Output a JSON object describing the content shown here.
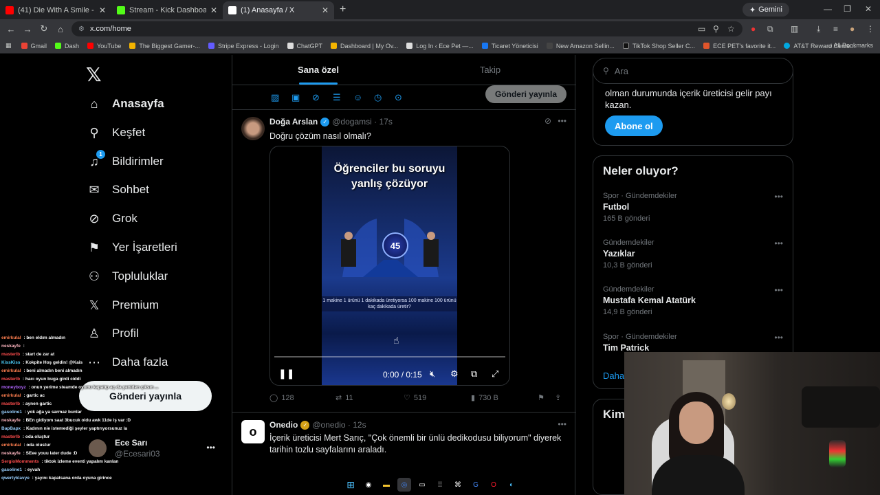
{
  "browser": {
    "tabs": [
      {
        "title": "(41) Die With A Smile - Lady Ga",
        "fav_color": "#ff0000",
        "active": false
      },
      {
        "title": "Stream - Kick Dashboard",
        "fav_color": "#53fc18",
        "active": false
      },
      {
        "title": "(1) Anasayfa / X",
        "fav_color": "#ffffff",
        "active": true
      }
    ],
    "new_tab": "+",
    "gemini": "Gemini",
    "url": "x.com/home",
    "bookmarks": [
      {
        "label": "Gmail",
        "color": "#ea4335"
      },
      {
        "label": "Dash",
        "color": "#53fc18"
      },
      {
        "label": "YouTube",
        "color": "#ff0000"
      },
      {
        "label": "The Biggest Gamer-...",
        "color": "#f4b400"
      },
      {
        "label": "Stripe Express - Login",
        "color": "#635bff"
      },
      {
        "label": "ChatGPT",
        "color": "#dddddd"
      },
      {
        "label": "Dashboard | My Ov...",
        "color": "#f4b400"
      },
      {
        "label": "Log In ‹ Ece Pet —...",
        "color": "#dddddd"
      },
      {
        "label": "Ticaret Yöneticisi",
        "color": "#1877f2"
      },
      {
        "label": "New Amazon Sellin...",
        "color": "#222222"
      },
      {
        "label": "TikTok Shop Seller C...",
        "color": "#111111"
      },
      {
        "label": "ECE PET's favorite it...",
        "color": "#e0552b"
      },
      {
        "label": "AT&T Reward Cente...",
        "color": "#00a8e0"
      }
    ],
    "all_bookmarks": "All Bookmarks"
  },
  "nav": {
    "items": [
      {
        "label": "Anasayfa",
        "icon": "home-icon",
        "glyph": "⌂"
      },
      {
        "label": "Keşfet",
        "icon": "search-icon",
        "glyph": "⚲"
      },
      {
        "label": "Bildirimler",
        "icon": "bell-icon",
        "glyph": "🔔︎"
      },
      {
        "label": "Sohbet",
        "icon": "mail-icon",
        "glyph": "✉"
      },
      {
        "label": "Grok",
        "icon": "grok-icon",
        "glyph": "⊘"
      },
      {
        "label": "Yer İşaretleri",
        "icon": "bookmark-icon",
        "glyph": "🔖︎"
      },
      {
        "label": "Topluluklar",
        "icon": "communities-icon",
        "glyph": "👥︎"
      },
      {
        "label": "Premium",
        "icon": "x-premium-icon",
        "glyph": "𝕏"
      },
      {
        "label": "Profil",
        "icon": "profile-icon",
        "glyph": "👤︎"
      },
      {
        "label": "Daha fazla",
        "icon": "more-circle-icon",
        "glyph": "⋯"
      }
    ],
    "notif_count": "1",
    "post_button": "Gönderi yayınla",
    "account": {
      "name": "Ece Sarı",
      "handle": "@Ecesari03"
    }
  },
  "feed": {
    "tabs": [
      "Sana özel",
      "Takip"
    ],
    "composer_post_button": "Gönderi yayınla",
    "posts": [
      {
        "name": "Doğa Arslan",
        "handle": "@dogamsi",
        "time": "17s",
        "text": "Doğru çözüm nasıl olmalı?",
        "video": {
          "overlay_title": "Öğrenciler bu soruyu yanlış çözüyor",
          "badge": "45",
          "question": "1 makine 1 ürünü 1 dakikada üretiyorsa 100 makine 100 ürünü kaç dakikada üretir?",
          "time": "0:00 / 0:15",
          "progress": 0
        },
        "stats": {
          "replies": "128",
          "reposts": "11",
          "likes": "519",
          "views": "730 B"
        }
      },
      {
        "name": "Onedio",
        "handle": "@onedio",
        "time": "12s",
        "text": "İçerik üreticisi Mert Sarıç, \"Çok önemli bir ünlü dedikodusu biliyorum\" diyerek tarihin tozlu sayfalarını araladı."
      }
    ]
  },
  "right": {
    "search_placeholder": "Ara",
    "premium_text": "olman durumunda içerik üreticisi gelir payı kazan.",
    "subscribe_button": "Abone ol",
    "trends_title": "Neler oluyor?",
    "trends": [
      {
        "context": "Spor · Gündemdekiler",
        "name": "Futbol",
        "posts": "165 B gönderi"
      },
      {
        "context": "Gündemdekiler",
        "name": "Yazıklar",
        "posts": "10,3 B gönderi"
      },
      {
        "context": "Gündemdekiler",
        "name": "Mustafa Kemal Atatürk",
        "posts": "14,9 B gönderi"
      },
      {
        "context": "Spor · Gündemdekiler",
        "name": "Tim Patrick",
        "posts": ""
      }
    ],
    "show_more": "Daha",
    "who_to_follow": "Kim"
  },
  "chat": [
    {
      "user": "emirkulal",
      "color": "#ff7f50",
      "msg": "ben eldım almadın"
    },
    {
      "user": "neskayfe",
      "color": "#ffb6c1",
      "msg": ""
    },
    {
      "user": "masterlb",
      "color": "#ff4d4d",
      "msg": "start de zar at"
    },
    {
      "user": "KissKiss",
      "color": "#4dd2ff",
      "msg": "Kokpite Hoş geldin! @Kais"
    },
    {
      "user": "emirkulal",
      "color": "#ff7f50",
      "msg": "beni almadın beni almadın"
    },
    {
      "user": "masterlb",
      "color": "#ff4d4d",
      "msg": "hacı oyun buga girdi ciddi"
    },
    {
      "user": "moneyboyz",
      "color": "#b266ff",
      "msg": "onun yerime steamde oyunu kapatıp aç da yeniden çıksın ..."
    },
    {
      "user": "emirkulal",
      "color": "#ff7f50",
      "msg": "gartic ac"
    },
    {
      "user": "masterlb",
      "color": "#ff4d4d",
      "msg": "aynen gartic"
    },
    {
      "user": "gasoline1",
      "color": "#9ad0ff",
      "msg": "yok ağa ya sarmaz bunlar"
    },
    {
      "user": "neskayfe",
      "color": "#ffb6c1",
      "msg": "BEn gidiyom saat 3bucuk oldu awk 11de iş var :D"
    },
    {
      "user": "BapBapx",
      "color": "#9ad0ff",
      "msg": "Kadının nie istemediği şeyler yaptırıyorsunuz la"
    },
    {
      "user": "masterlb",
      "color": "#ff4d4d",
      "msg": "oda oluştur"
    },
    {
      "user": "emirkulal",
      "color": "#ff7f50",
      "msg": "oda olustur"
    },
    {
      "user": "neskayfe",
      "color": "#ffb6c1",
      "msg": "SEee youu later dude :D"
    },
    {
      "user": "SergioMomments",
      "color": "#ff4d4d",
      "msg": "tiktok izleme eventi yapalım kanlan"
    },
    {
      "user": "gasoline1",
      "color": "#9ad0ff",
      "msg": "eyvah"
    },
    {
      "user": "qwertyklavye",
      "color": "#9ad0ff",
      "msg": "yayını kapatsana orda oyuna girince"
    }
  ]
}
